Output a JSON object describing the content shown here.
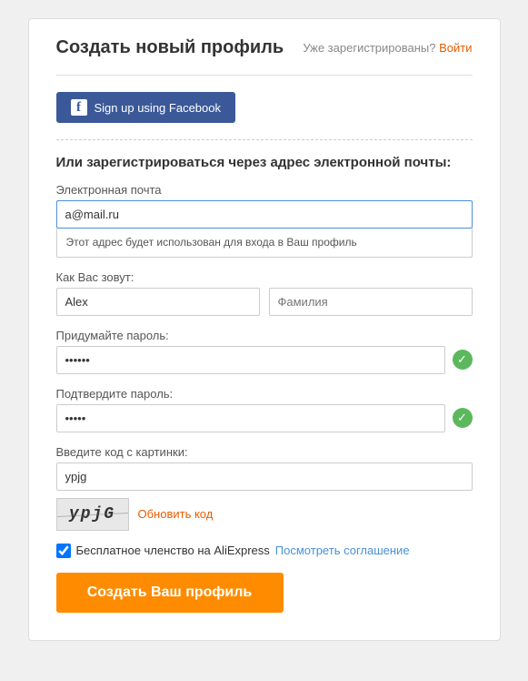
{
  "header": {
    "title": "Создать новый профиль",
    "already_registered": "Уже зарегистрированы?",
    "login_link": "Войти"
  },
  "facebook": {
    "button_label": "Sign up using Facebook",
    "icon": "f"
  },
  "form": {
    "section_title": "Или зарегистрироваться через адрес электронной почты:",
    "email_label": "Электронная почта",
    "email_value": "a@mail.ru",
    "email_tooltip": "Этот адрес будет использован для входа в Ваш профиль",
    "name_label": "Как Вас зовут:",
    "first_name_value": "Alex",
    "last_name_placeholder": "Фамилия",
    "password_label": "Придумайте пароль:",
    "password_value": "••••••",
    "confirm_label": "Подтвердите пароль:",
    "confirm_value": "•••••",
    "captcha_label": "Введите код с картинки:",
    "captcha_value": "ypjg",
    "captcha_image_text": "ypjG",
    "refresh_label": "Обновить код",
    "agreement_text": "Бесплатное членство на AliExpress",
    "agreement_link": "Посмотреть соглашение",
    "submit_label": "Создать Ваш профиль"
  }
}
